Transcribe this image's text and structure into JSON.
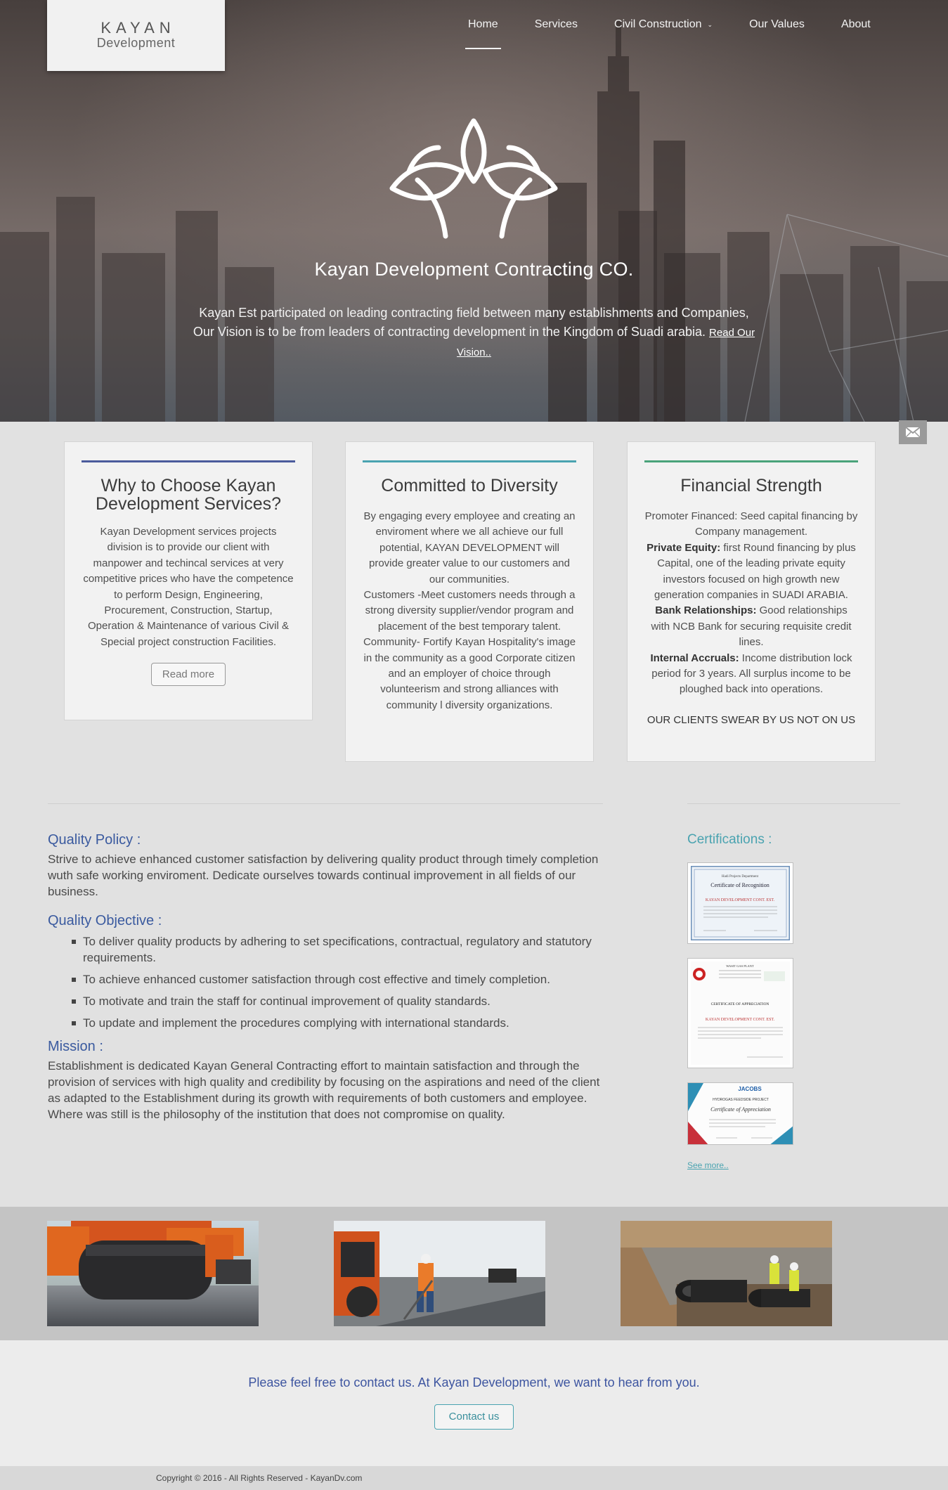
{
  "brand": {
    "title": "KAYAN",
    "subtitle": "Development"
  },
  "nav": {
    "items": [
      {
        "label": "Home",
        "active": true
      },
      {
        "label": "Services"
      },
      {
        "label": "Civil Construction",
        "has_dropdown": true
      },
      {
        "label": "Our Values"
      },
      {
        "label": "About"
      }
    ]
  },
  "hero": {
    "title": "Kayan Development Contracting CO.",
    "text": "Kayan Est participated on leading contracting field between many establishments and Companies, Our Vision is to be from leaders of contracting development in the Kingdom of Suadi arabia.",
    "link": "Read Our Vision.."
  },
  "cards": [
    {
      "title": "Why to Choose Kayan Development Services?",
      "accent": "#4b5b9c",
      "body": "Kayan Development services projects division is to provide our client with manpower and techincal services at very competitive prices who have the competence to perform Design, Engineering, Procurement, Construction, Startup, Operation & Maintenance of various Civil & Special project construction Facilities.",
      "button": "Read more"
    },
    {
      "title": "Committed to Diversity",
      "accent": "#4aa3b0",
      "paragraphs": [
        "By engaging every employee and creating an enviroment where we all achieve our full potential, KAYAN DEVELOPMENT will provide greater value to our customers and our communities.",
        "Customers -Meet customers needs through a strong diversity supplier/vendor program and placement of the best temporary talent.",
        "Community- Fortify Kayan Hospitality's image in the community as a good Corporate citizen and an employer of choice through volunteerism and strong alliances with community l diversity organizations."
      ]
    },
    {
      "title": "Financial Strength",
      "accent": "#4aa37a",
      "p1": "Promoter Financed: Seed capital financing by Company management.",
      "p2_label": "Private Equity:",
      "p2": " first Round financing by plus Capital, one of the leading private equity investors focused on high growth new generation companies in SUADI ARABIA.",
      "p3_label": "Bank Relationships:",
      "p3": " Good relationships with NCB Bank for securing requisite credit lines.",
      "p4_label": "Internal Accruals:",
      "p4": " Income distribution lock period for 3 years. All surplus income to be ploughed back into operations.",
      "tagline": "OUR CLIENTS SWEAR BY US NOT ON US"
    }
  ],
  "quality": {
    "policy_head": "Quality Policy :",
    "policy": "Strive to achieve enhanced customer satisfaction by delivering quality product through timely completion wuth safe working enviroment. Dedicate ourselves towards continual improvement in all fields of our business.",
    "objective_head": "Quality Objective :",
    "objectives": [
      "To deliver quality products by adhering to set specifications, contractual, regulatory and statutory requirements.",
      "To achieve enhanced customer satisfaction through cost effective and timely completion.",
      "To motivate and train the staff for continual improvement of quality standards.",
      "To update and implement the procedures complying with international standards."
    ],
    "mission_head": "Mission :",
    "mission": "Establishment is dedicated Kayan General Contracting effort to maintain satisfaction and through the provision of services with high quality and credibility by focusing on the aspirations and need of the client as adapted to the Establishment during its growth with requirements of both customers and employee. Where was still is the philosophy of the institution that does not compromise on quality."
  },
  "certifications": {
    "head": "Certifications :",
    "see_more": "See more..",
    "cert1": {
      "line1": "Hadi Projects Department",
      "title": "Certificate of Recognition",
      "company": "KAYAN DEVELOPMENT CONT. EST."
    },
    "cert2": {
      "line1": "WASIT GAS PLANT",
      "title": "CERTIFICATE OF APPRECIATION",
      "company": "KAYAN DEVELOPMENT CONT. EST."
    },
    "cert3": {
      "brand": "JACOBS",
      "line1": "HYDROGAS FEEDSIDE PROJECT",
      "title": "Certificate of Appreciation"
    }
  },
  "contact": {
    "text": "Please feel free to contact us. At Kayan Development, we want to hear from you.",
    "button": "Contact us"
  },
  "footer": {
    "copyright": "Copyright © 2016 - All Rights Reserved - KayanDv.com"
  },
  "colors": {
    "accent_blue": "#3a5a9f",
    "accent_teal": "#4aa3b0",
    "accent_green": "#4aa37a"
  },
  "icons": {
    "mail": "envelope-icon",
    "emblem": "leaf-emblem-icon",
    "dropdown": "chevron-down-icon"
  }
}
